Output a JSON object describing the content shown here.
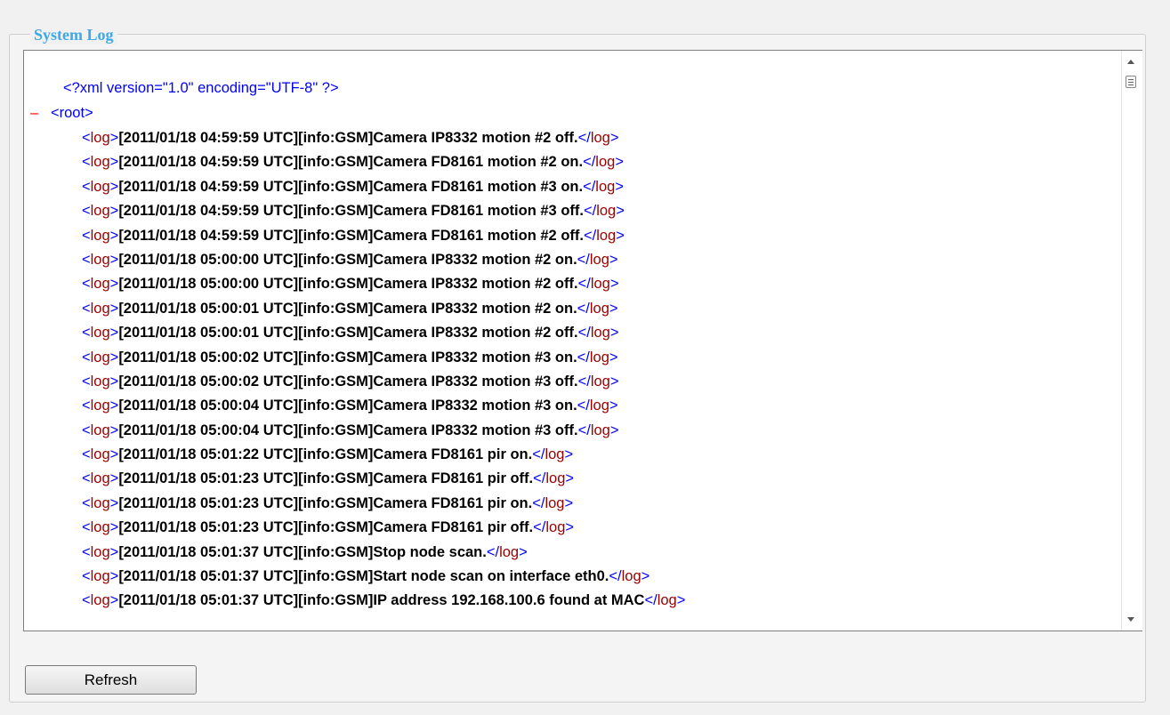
{
  "section": {
    "legend": "System Log"
  },
  "log": {
    "declaration": "<?xml version=\"1.0\" encoding=\"UTF-8\" ?>",
    "collapse_symbol": "–",
    "root_open": "<root>",
    "tag_open_left": "<",
    "tag_open_name": "log",
    "tag_open_right": ">",
    "tag_close_left": "</",
    "tag_close_name": "log",
    "tag_close_right": ">",
    "entries": [
      "[2011/01/18 04:59:59 UTC][info:GSM]Camera IP8332 motion #2 off.",
      "[2011/01/18 04:59:59 UTC][info:GSM]Camera FD8161 motion #2 on.",
      "[2011/01/18 04:59:59 UTC][info:GSM]Camera FD8161 motion #3 on.",
      "[2011/01/18 04:59:59 UTC][info:GSM]Camera FD8161 motion #3 off.",
      "[2011/01/18 04:59:59 UTC][info:GSM]Camera FD8161 motion #2 off.",
      "[2011/01/18 05:00:00 UTC][info:GSM]Camera IP8332 motion #2 on.",
      "[2011/01/18 05:00:00 UTC][info:GSM]Camera IP8332 motion #2 off.",
      "[2011/01/18 05:00:01 UTC][info:GSM]Camera IP8332 motion #2 on.",
      "[2011/01/18 05:00:01 UTC][info:GSM]Camera IP8332 motion #2 off.",
      "[2011/01/18 05:00:02 UTC][info:GSM]Camera IP8332 motion #3 on.",
      "[2011/01/18 05:00:02 UTC][info:GSM]Camera IP8332 motion #3 off.",
      "[2011/01/18 05:00:04 UTC][info:GSM]Camera IP8332 motion #3 on.",
      "[2011/01/18 05:00:04 UTC][info:GSM]Camera IP8332 motion #3 off.",
      "[2011/01/18 05:01:22 UTC][info:GSM]Camera FD8161 pir on.",
      "[2011/01/18 05:01:23 UTC][info:GSM]Camera FD8161 pir off.",
      "[2011/01/18 05:01:23 UTC][info:GSM]Camera FD8161 pir on.",
      "[2011/01/18 05:01:23 UTC][info:GSM]Camera FD8161 pir off.",
      "[2011/01/18 05:01:37 UTC][info:GSM]Stop node scan.",
      "[2011/01/18 05:01:37 UTC][info:GSM]Start node scan on interface eth0.",
      "[2011/01/18 05:01:37 UTC][info:GSM]IP address 192.168.100.6 found at MAC"
    ]
  },
  "buttons": {
    "refresh": "Refresh"
  }
}
